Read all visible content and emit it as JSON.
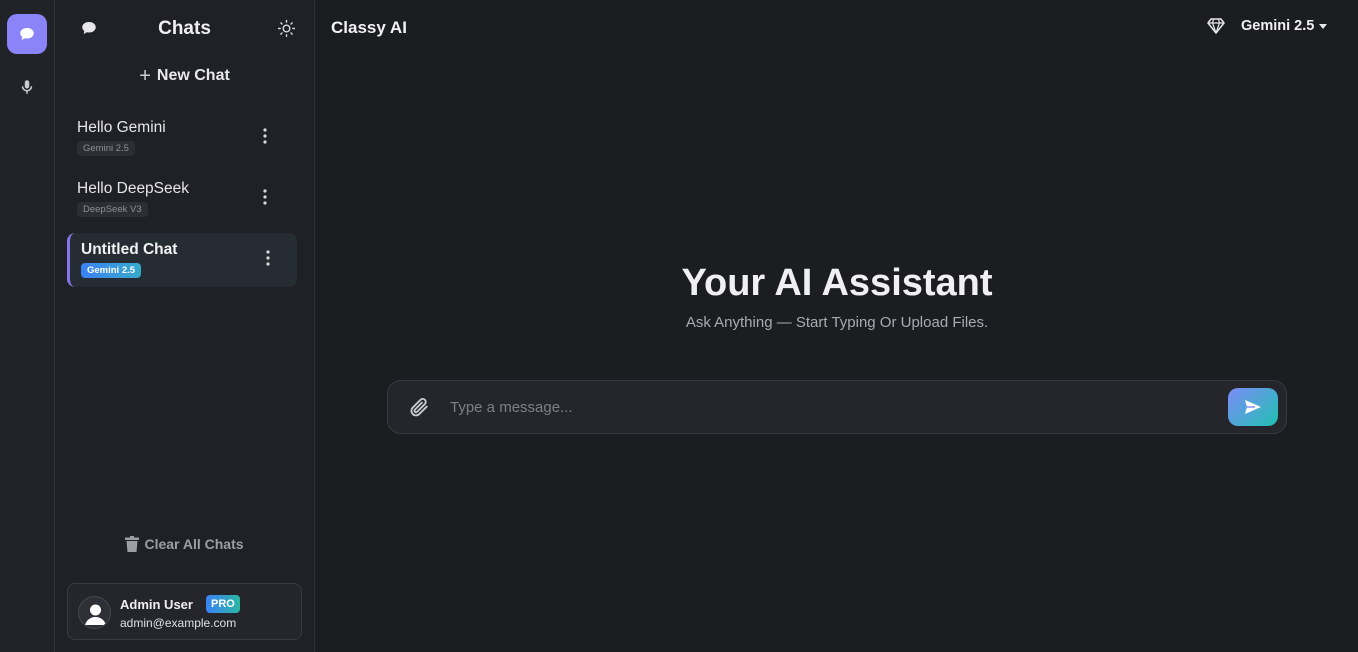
{
  "rail": {
    "items": [
      {
        "name": "chats",
        "icon": "chat-bubble-icon",
        "active": true
      },
      {
        "name": "voice",
        "icon": "microphone-icon",
        "active": false
      }
    ]
  },
  "sidebar": {
    "title": "Chats",
    "new_chat_label": "New Chat",
    "chats": [
      {
        "title": "Hello Gemini",
        "model": "Gemini 2.5",
        "active": false
      },
      {
        "title": "Hello DeepSeek",
        "model": "DeepSeek V3",
        "active": false
      },
      {
        "title": "Untitled Chat",
        "model": "Gemini 2.5",
        "active": true
      }
    ],
    "clear_all_label": "Clear All Chats",
    "user": {
      "name": "Admin User",
      "plan": "PRO",
      "email": "admin@example.com"
    }
  },
  "header": {
    "app_title": "Classy AI",
    "model_selected": "Gemini 2.5"
  },
  "hero": {
    "title": "Your AI Assistant",
    "subtitle": "Ask Anything — Start Typing Or Upload Files."
  },
  "composer": {
    "placeholder": "Type a message...",
    "value": ""
  },
  "colors": {
    "accent": "#8a84f8",
    "badge_gradient_start": "#3b82f6",
    "send_gradient_end": "#20c0b0",
    "background": "#1c1d21"
  }
}
